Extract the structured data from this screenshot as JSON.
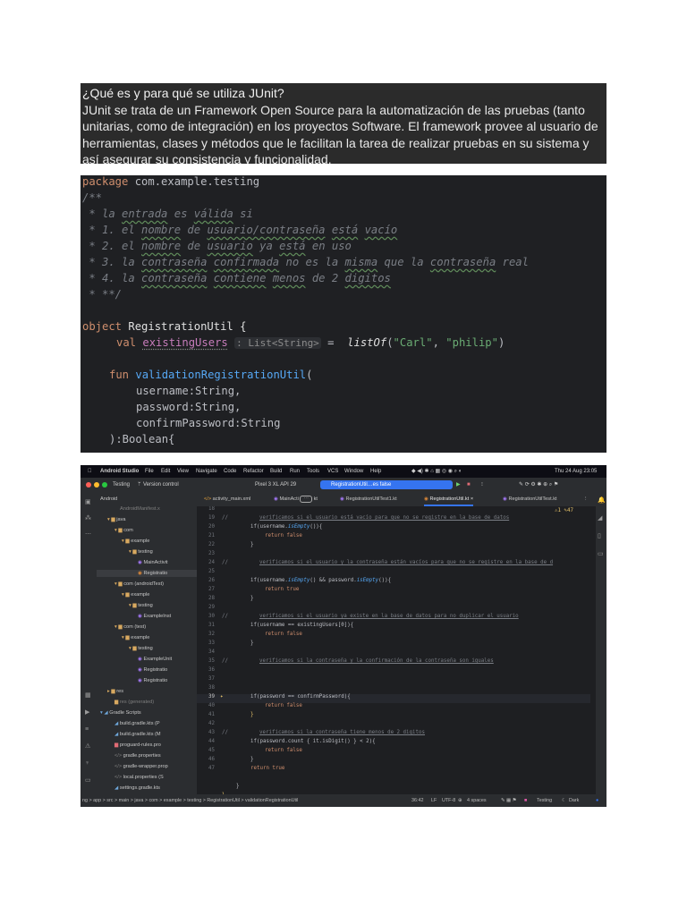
{
  "intro": {
    "title": "¿Qué es y para qué se utiliza JUnit?",
    "body": "JUnit se trata de un Framework Open Source para la automatización de las pruebas (tanto unitarias, como de integración) en los proyectos Software. El framework provee al usuario de herramientas, clases y métodos que le facilitan la tarea de realizar pruebas en su sistema y así asegurar su consistencia y funcionalidad."
  },
  "code": {
    "l1_kw": "package",
    "l1_rest": " com.example.testing",
    "l2": "/**",
    "l3_a": " * la ",
    "l3_b": "entrada",
    "l3_c": " es ",
    "l3_d": "válida",
    "l3_e": " si",
    "l4_a": " * 1. el ",
    "l4_b": "nombre",
    "l4_c": " de ",
    "l4_d": "usuario/contraseña",
    "l4_e": " ",
    "l4_f": "está",
    "l4_g": " ",
    "l4_h": "vacío",
    "l5_a": " * 2. el ",
    "l5_b": "nombre",
    "l5_c": " de ",
    "l5_d": "usuario",
    "l5_e": " ya ",
    "l5_f": "está",
    "l5_g": " en uso",
    "l6_a": " * 3. la ",
    "l6_b": "contraseña",
    "l6_c": " ",
    "l6_d": "confirmada",
    "l6_e": " no es la ",
    "l6_f": "misma",
    "l6_g": " que la ",
    "l6_h": "contraseña",
    "l6_i": " real",
    "l7_a": " * 4. la ",
    "l7_b": "contraseña",
    "l7_c": " ",
    "l7_d": "contiene",
    "l7_e": " ",
    "l7_f": "menos",
    "l7_g": " de 2 ",
    "l7_h": "digitos",
    "l8": " * **/",
    "l9_kw": "object",
    "l9_rest": " RegistrationUtil {",
    "l10_kw": "val",
    "l10_prop": "existingUsers",
    "l10_hint": ": List<String>",
    "l10_eq": " = ",
    "l10_fn": "listOf",
    "l10_p1": "(",
    "l10_s1": "\"Carl\"",
    "l10_c": ", ",
    "l10_s2": "\"philip\"",
    "l10_p2": ")",
    "l11_kw": "fun",
    "l11_fn": "validationRegistrationUtil",
    "l11_p": "(",
    "l12": "username:String,",
    "l13": "password:String,",
    "l14": "confirmPassword:String",
    "l15": "):Boolean{"
  },
  "ide": {
    "menu": [
      "Android Studio",
      "File",
      "Edit",
      "View",
      "Navigate",
      "Code",
      "Refactor",
      "Build",
      "Run",
      "Tools",
      "VCS",
      "Window",
      "Help"
    ],
    "clock": "Thu 24 Aug  23:05",
    "project_name": "Testing",
    "vcs": "Version control",
    "device": "Pixel 3 XL API 29",
    "run_config": "RegistrationUtil…es false",
    "tree": {
      "header": "Android",
      "items": [
        "AndroidManifest.x",
        "java",
        "com",
        "example",
        "testing",
        "MainActivit",
        "Registratio",
        "com (androidTest)",
        "example",
        "testing",
        "ExampleInst",
        "com (test)",
        "example",
        "testing",
        "ExampleUnit",
        "Registratio",
        "Registratio",
        "res",
        "res (generated)",
        "Gradle Scripts",
        "build.gradle.kts (P",
        "build.gradle.kts (M",
        "proguard-rules.pro",
        "gradle.properties",
        "gradle-wrapper.prop",
        "local.properties (S",
        "settings.gradle.kts"
      ]
    },
    "tabs": [
      "activity_main.xml",
      "MainActi",
      "kt",
      "RegistrationUtilTest1.kt",
      "RegistrationUtil.kt",
      "RegistrationUtilTest.kt"
    ],
    "warnings": "⚠1 ✎47",
    "editor": {
      "gutter": [
        "18",
        "19",
        "20",
        "21",
        "22",
        "23",
        "24",
        "25",
        "26",
        "27",
        "28",
        "29",
        "30",
        "31",
        "32",
        "33",
        "34",
        "35",
        "36",
        "37",
        "38",
        "39",
        "40",
        "41",
        "42",
        "43",
        "44",
        "45",
        "46",
        "47"
      ],
      "c19_pre": "//",
      "c19": "verificamos si el usuario está vacío para que no se registre en la base de datos",
      "c20": "if(username.",
      "c20_fn": "isEmpty",
      "c20_end": "()){",
      "c21": "return false",
      "c22": "}",
      "c24_pre": "//",
      "c24": "verificamos si el usuario y la contraseña están vacíos para que no se registre en la base de d",
      "c26": "if(username.",
      "c26_fn": "isEmpty",
      "c26_mid": "() && password.",
      "c26_fn2": "isEmpty",
      "c26_end": "()){",
      "c27": "return true",
      "c28": "}",
      "c30_pre": "//",
      "c30": "verificamos si el usuario ya existe en la base de datos para no duplicar el usuario",
      "c31": "if(username == existingUsers[0]){",
      "c32": "return false",
      "c33": "}",
      "c35_pre": "//",
      "c35": "verificamos si la contraseña y la confirmación de la contraseña son iguales",
      "c36": "if(password == confirmPassword){",
      "c37": "return false",
      "c38": "}",
      "c40_pre": "//",
      "c40": "verificamos si la contraseña tiene menos de 2 digitos",
      "c41": "if(password.count { it.isDigit() } < 2){",
      "c42": "return false",
      "c43": "}",
      "c44": "return true",
      "c46": "}",
      "c47": "}"
    },
    "status": {
      "path": "ng > app > src > main > java > com > example > testing > RegistrationUtil > validationRegistrationUtil",
      "pos": "36:42",
      "lf": "LF",
      "enc": "UTF-8",
      "indent": "4 spaces",
      "theme": "Testing",
      "mode": "Dark"
    }
  }
}
